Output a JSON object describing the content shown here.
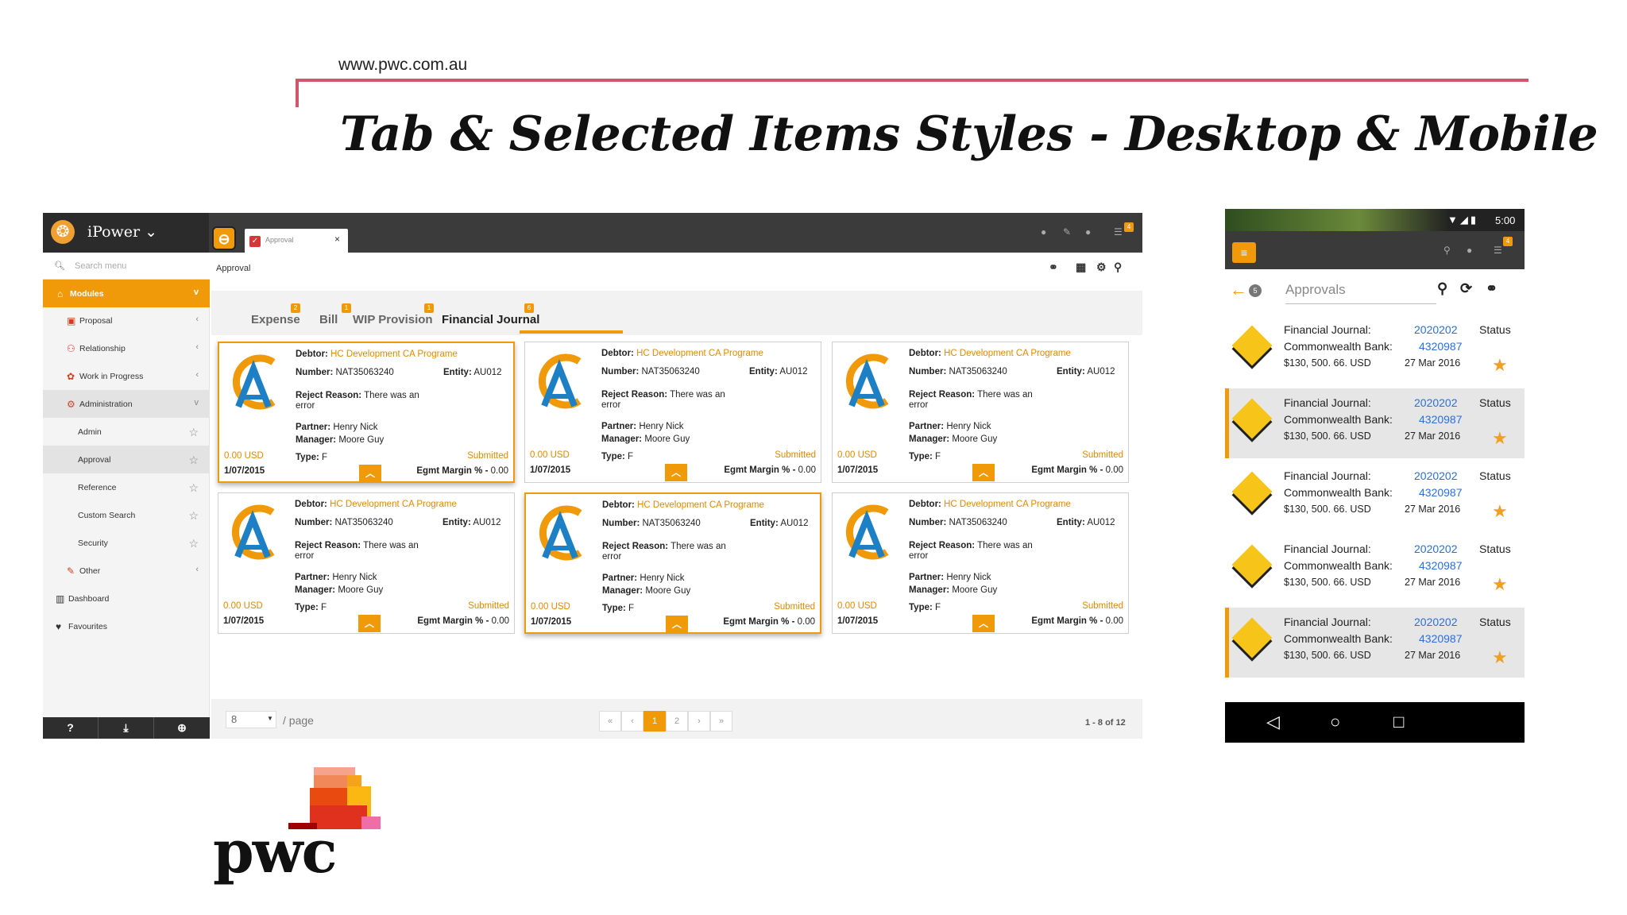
{
  "slide": {
    "url": "www.pwc.com.au",
    "title": "Tab & Selected Items Styles - Desktop & Mobile",
    "brand_word": "pwc"
  },
  "desktop": {
    "app_name": "iPower",
    "open_tab": "Approval",
    "search_placeholder": "Search menu",
    "breadcrumb": "Approval",
    "sidebar": [
      {
        "label": "Modules",
        "icon": "home-icon",
        "style": "modules",
        "chevron": "v"
      },
      {
        "label": "Proposal",
        "icon": "proposal-icon",
        "chevron": "‹"
      },
      {
        "label": "Relationship",
        "icon": "relationship-icon",
        "chevron": "‹"
      },
      {
        "label": "Work in Progress",
        "icon": "work-icon",
        "chevron": "‹"
      },
      {
        "label": "Administration",
        "icon": "admin-icon",
        "style": "highlight",
        "chevron": "v"
      },
      {
        "label": "Admin",
        "icon": "star-icon"
      },
      {
        "label": "Approval",
        "icon": "star-icon",
        "style": "highlight"
      },
      {
        "label": "Reference",
        "icon": "star-icon"
      },
      {
        "label": "Custom Search",
        "icon": "star-icon"
      },
      {
        "label": "Security",
        "icon": "star-icon"
      },
      {
        "label": "Other",
        "icon": "other-icon",
        "chevron": "‹"
      },
      {
        "label": "Dashboard",
        "icon": "dashboard-icon"
      },
      {
        "label": "Favourites",
        "icon": "heart-icon"
      }
    ],
    "sidebar_footer": [
      "?",
      "⤓",
      "⊕"
    ],
    "tabs": [
      {
        "label": "Expense",
        "badge": "2"
      },
      {
        "label": "Bill",
        "badge": "1"
      },
      {
        "label": "WIP Provision",
        "badge": "1"
      },
      {
        "label": "Financial Journal",
        "badge": "6",
        "active": true
      }
    ],
    "card_labels": {
      "debtor": "Debtor:",
      "number": "Number:",
      "entity": "Entity:",
      "reject": "Reject Reason:",
      "partner": "Partner:",
      "manager": "Manager:",
      "type": "Type:",
      "margin": "Egmt Margin % -"
    },
    "cards": [
      {
        "debtor": "HC Development CA Programe",
        "number": "NAT35063240",
        "entity": "AU012",
        "reason1": "There was an",
        "reason2": "error",
        "partner": "Henry Nick",
        "manager": "Moore Guy",
        "type": "F",
        "amount": "0.00 USD",
        "status": "Submitted",
        "date": "1/07/2015",
        "margin": "0.00",
        "selected": true
      },
      {
        "debtor": "HC Development CA Programe",
        "number": "NAT35063240",
        "entity": "AU012",
        "reason1": "There was an",
        "reason2": "error",
        "partner": "Henry Nick",
        "manager": "Moore Guy",
        "type": "F",
        "amount": "0.00 USD",
        "status": "Submitted",
        "date": "1/07/2015",
        "margin": "0.00",
        "selected": false
      },
      {
        "debtor": "HC Development CA Programe",
        "number": "NAT35063240",
        "entity": "AU012",
        "reason1": "There was an",
        "reason2": "error",
        "partner": "Henry Nick",
        "manager": "Moore Guy",
        "type": "F",
        "amount": "0.00 USD",
        "status": "Submitted",
        "date": "1/07/2015",
        "margin": "0.00",
        "selected": false
      },
      {
        "debtor": "HC Development CA Programe",
        "number": "NAT35063240",
        "entity": "AU012",
        "reason1": "There was an",
        "reason2": "error",
        "partner": "Henry Nick",
        "manager": "Moore Guy",
        "type": "F",
        "amount": "0.00 USD",
        "status": "Submitted",
        "date": "1/07/2015",
        "margin": "0.00",
        "selected": false
      },
      {
        "debtor": "HC Development CA Programe",
        "number": "NAT35063240",
        "entity": "AU012",
        "reason1": "There was an",
        "reason2": "error",
        "partner": "Henry Nick",
        "manager": "Moore Guy",
        "type": "F",
        "amount": "0.00 USD",
        "status": "Submitted",
        "date": "1/07/2015",
        "margin": "0.00",
        "selected": true
      },
      {
        "debtor": "HC Development CA Programe",
        "number": "NAT35063240",
        "entity": "AU012",
        "reason1": "There was an",
        "reason2": "error",
        "partner": "Henry Nick",
        "manager": "Moore Guy",
        "type": "F",
        "amount": "0.00 USD",
        "status": "Submitted",
        "date": "1/07/2015",
        "margin": "0.00",
        "selected": false
      }
    ],
    "pager": {
      "per_page": "8",
      "per_page_label": "/ page",
      "buttons": [
        "«",
        "‹",
        "1",
        "2",
        "›",
        "»"
      ],
      "current": "1",
      "range": "1 - 8 of 12"
    }
  },
  "mobile": {
    "time": "5:00",
    "badge": "4",
    "count": "5",
    "title": "Approvals",
    "rows": [
      {
        "label": "Financial Journal:",
        "id": "2020202",
        "status": "Status",
        "bank": "Commonwealth Bank:",
        "bank_no": "4320987",
        "amount": "$130, 500. 66. USD",
        "date": "27 Mar 2016",
        "selected": false
      },
      {
        "label": "Financial Journal:",
        "id": "2020202",
        "status": "Status",
        "bank": "Commonwealth Bank:",
        "bank_no": "4320987",
        "amount": "$130, 500. 66. USD",
        "date": "27 Mar 2016",
        "selected": true
      },
      {
        "label": "Financial Journal:",
        "id": "2020202",
        "status": "Status",
        "bank": "Commonwealth Bank:",
        "bank_no": "4320987",
        "amount": "$130, 500. 66. USD",
        "date": "27 Mar 2016",
        "selected": false
      },
      {
        "label": "Financial Journal:",
        "id": "2020202",
        "status": "Status",
        "bank": "Commonwealth Bank:",
        "bank_no": "4320987",
        "amount": "$130, 500. 66. USD",
        "date": "27 Mar 2016",
        "selected": false
      },
      {
        "label": "Financial Journal:",
        "id": "2020202",
        "status": "Status",
        "bank": "Commonwealth Bank:",
        "bank_no": "4320987",
        "amount": "$130, 500. 66. USD",
        "date": "27 Mar 2016",
        "selected": true
      }
    ]
  },
  "colors": {
    "accent": "#f09a0a",
    "rule": "#d4556a",
    "link_blue": "#2a6fdb"
  }
}
